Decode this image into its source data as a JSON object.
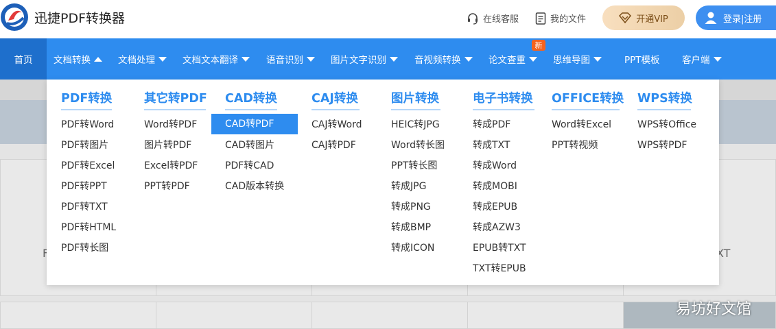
{
  "header": {
    "brand": "迅捷PDF转换器",
    "service_label": "在线客服",
    "files_label": "我的文件",
    "vip_label": "开通VIP",
    "login_label": "登录|注册"
  },
  "nav": {
    "items": [
      {
        "label": "首页"
      },
      {
        "label": "文档转换"
      },
      {
        "label": "文档处理"
      },
      {
        "label": "文档文本翻译"
      },
      {
        "label": "语音识别"
      },
      {
        "label": "图片文字识别"
      },
      {
        "label": "音视频转换"
      },
      {
        "label": "论文查重"
      },
      {
        "label": "思维导图"
      },
      {
        "label": "PPT模板"
      },
      {
        "label": "客户端"
      }
    ],
    "new_badge": "新"
  },
  "dropdown": {
    "columns": [
      {
        "title": "PDF转换",
        "items": [
          "PDF转Word",
          "PDF转图片",
          "PDF转Excel",
          "PDF转PPT",
          "PDF转TXT",
          "PDF转HTML",
          "PDF转长图"
        ]
      },
      {
        "title": "其它转PDF",
        "items": [
          "Word转PDF",
          "图片转PDF",
          "Excel转PDF",
          "PPT转PDF"
        ]
      },
      {
        "title": "CAD转换",
        "items": [
          "CAD转PDF",
          "CAD转图片",
          "PDF转CAD",
          "CAD版本转换"
        ]
      },
      {
        "title": "CAJ转换",
        "items": [
          "CAJ转Word",
          "CAJ转PDF"
        ]
      },
      {
        "title": "图片转换",
        "items": [
          "HEIC转JPG",
          "Word转长图",
          "PPT转长图",
          "转成JPG",
          "转成PNG",
          "转成BMP",
          "转成ICON"
        ]
      },
      {
        "title": "电子书转换",
        "items": [
          "转成PDF",
          "转成TXT",
          "转成Word",
          "转成MOBI",
          "转成EPUB",
          "转成AZW3",
          "EPUB转TXT",
          "TXT转EPUB"
        ]
      },
      {
        "title": "OFFICE转换",
        "items": [
          "Word转Excel",
          "PPT转视频"
        ]
      },
      {
        "title": "WPS转换",
        "items": [
          "WPS转Office",
          "WPS转PDF"
        ]
      }
    ]
  },
  "background": {
    "frag_left": "F",
    "frag_right": "XT"
  },
  "watermark": "易坊好文馆",
  "colors": {
    "primary": "#2e8cef",
    "home_active": "#1e6fcc",
    "badge": "#f5631e",
    "vip_gold": "#eccfa6"
  },
  "icons": {
    "service": "headset-icon",
    "files": "document-icon",
    "vip": "diamond-icon",
    "login": "user-icon"
  }
}
